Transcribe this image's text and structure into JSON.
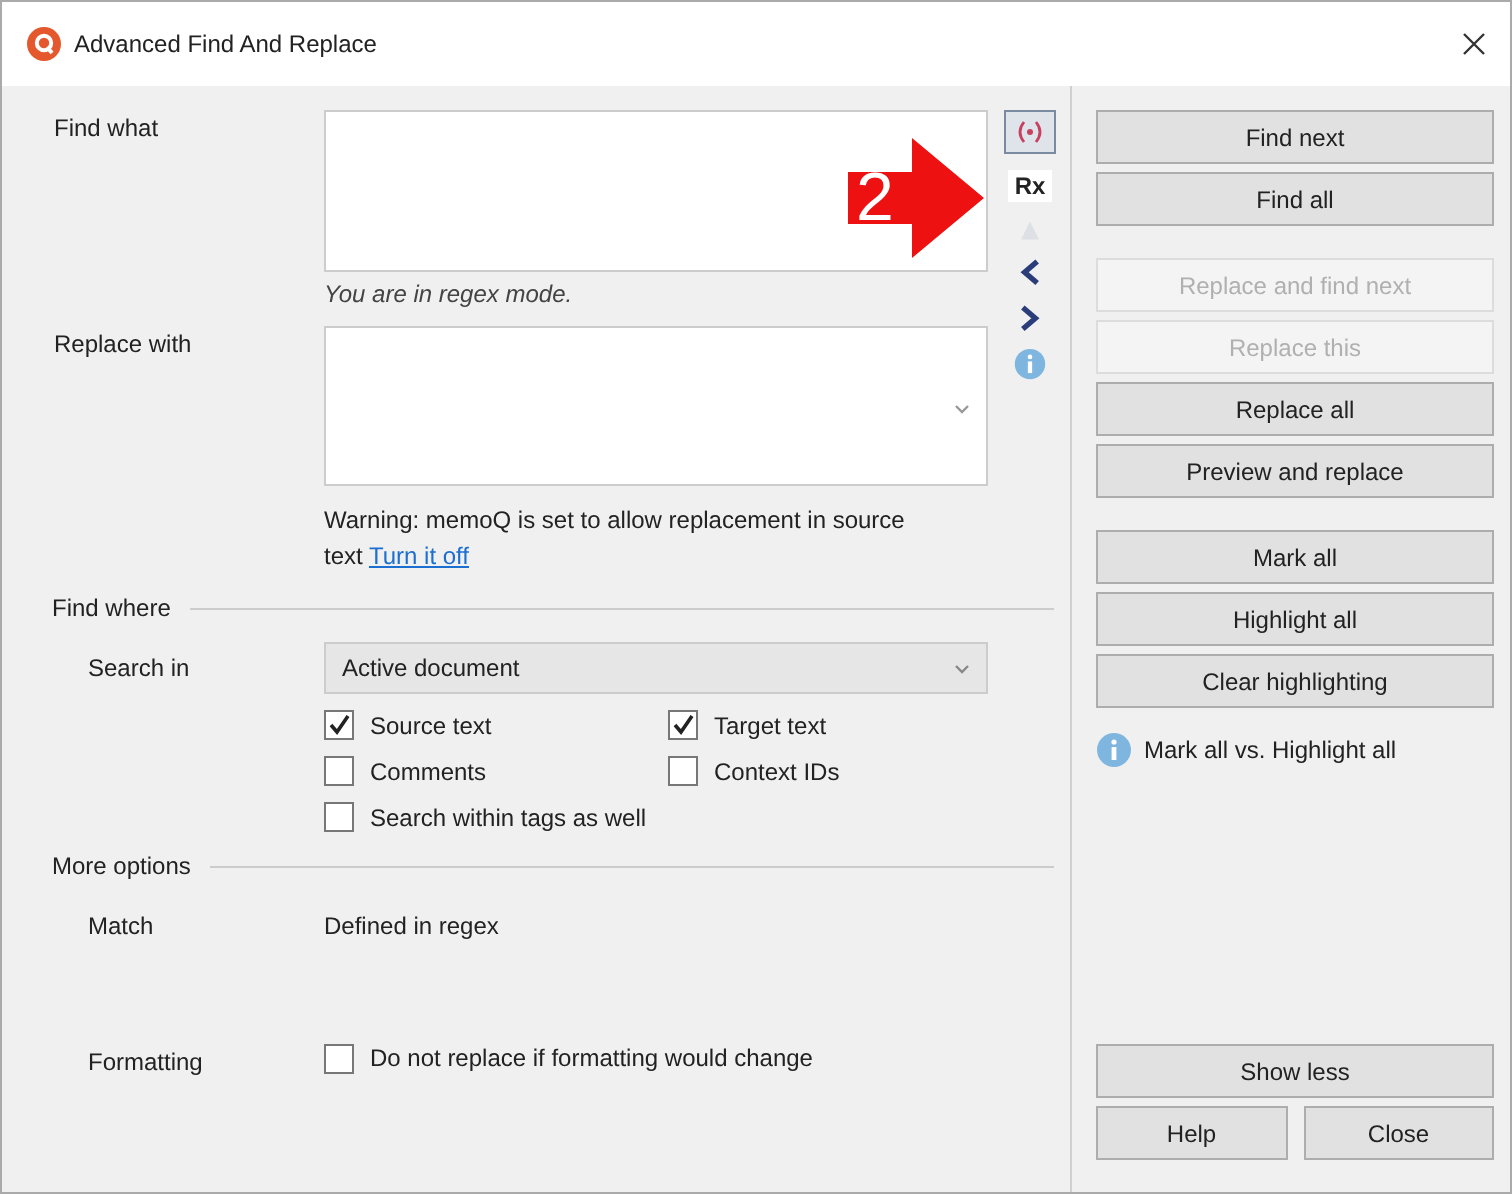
{
  "window": {
    "title": "Advanced Find And Replace"
  },
  "find": {
    "label": "Find what",
    "mode_note": "You are in regex mode."
  },
  "regex_tools": {
    "regex_on": true,
    "rx_label": "Rx"
  },
  "replace": {
    "label": "Replace with"
  },
  "warning": {
    "text": "Warning: memoQ is set to allow replacement in source text",
    "link": "Turn it off"
  },
  "find_where": {
    "heading": "Find where",
    "search_in_label": "Search in",
    "search_in_value": "Active document",
    "options": [
      {
        "label": "Source text",
        "checked": true
      },
      {
        "label": "Target text",
        "checked": true
      },
      {
        "label": "Comments",
        "checked": false
      },
      {
        "label": "Context IDs",
        "checked": false
      },
      {
        "label": "Search within tags as well",
        "checked": false
      }
    ]
  },
  "more_options": {
    "heading": "More options",
    "match_label": "Match",
    "match_value": "Defined in regex",
    "formatting_label": "Formatting",
    "formatting_option": {
      "label": "Do not replace if formatting would change",
      "checked": false
    }
  },
  "button_groups": [
    [
      {
        "label": "Find next",
        "disabled": false
      },
      {
        "label": "Find all",
        "disabled": false
      }
    ],
    [
      {
        "label": "Replace and find next",
        "disabled": true
      },
      {
        "label": "Replace this",
        "disabled": true
      },
      {
        "label": "Replace all",
        "disabled": false
      },
      {
        "label": "Preview and replace",
        "disabled": false
      }
    ],
    [
      {
        "label": "Mark all",
        "disabled": false
      },
      {
        "label": "Highlight all",
        "disabled": false
      },
      {
        "label": "Clear highlighting",
        "disabled": false
      }
    ]
  ],
  "info_link": "Mark all vs. Highlight all",
  "bottom_buttons": {
    "show_less": "Show less",
    "help": "Help",
    "close": "Close"
  },
  "callout": {
    "label": "2"
  }
}
